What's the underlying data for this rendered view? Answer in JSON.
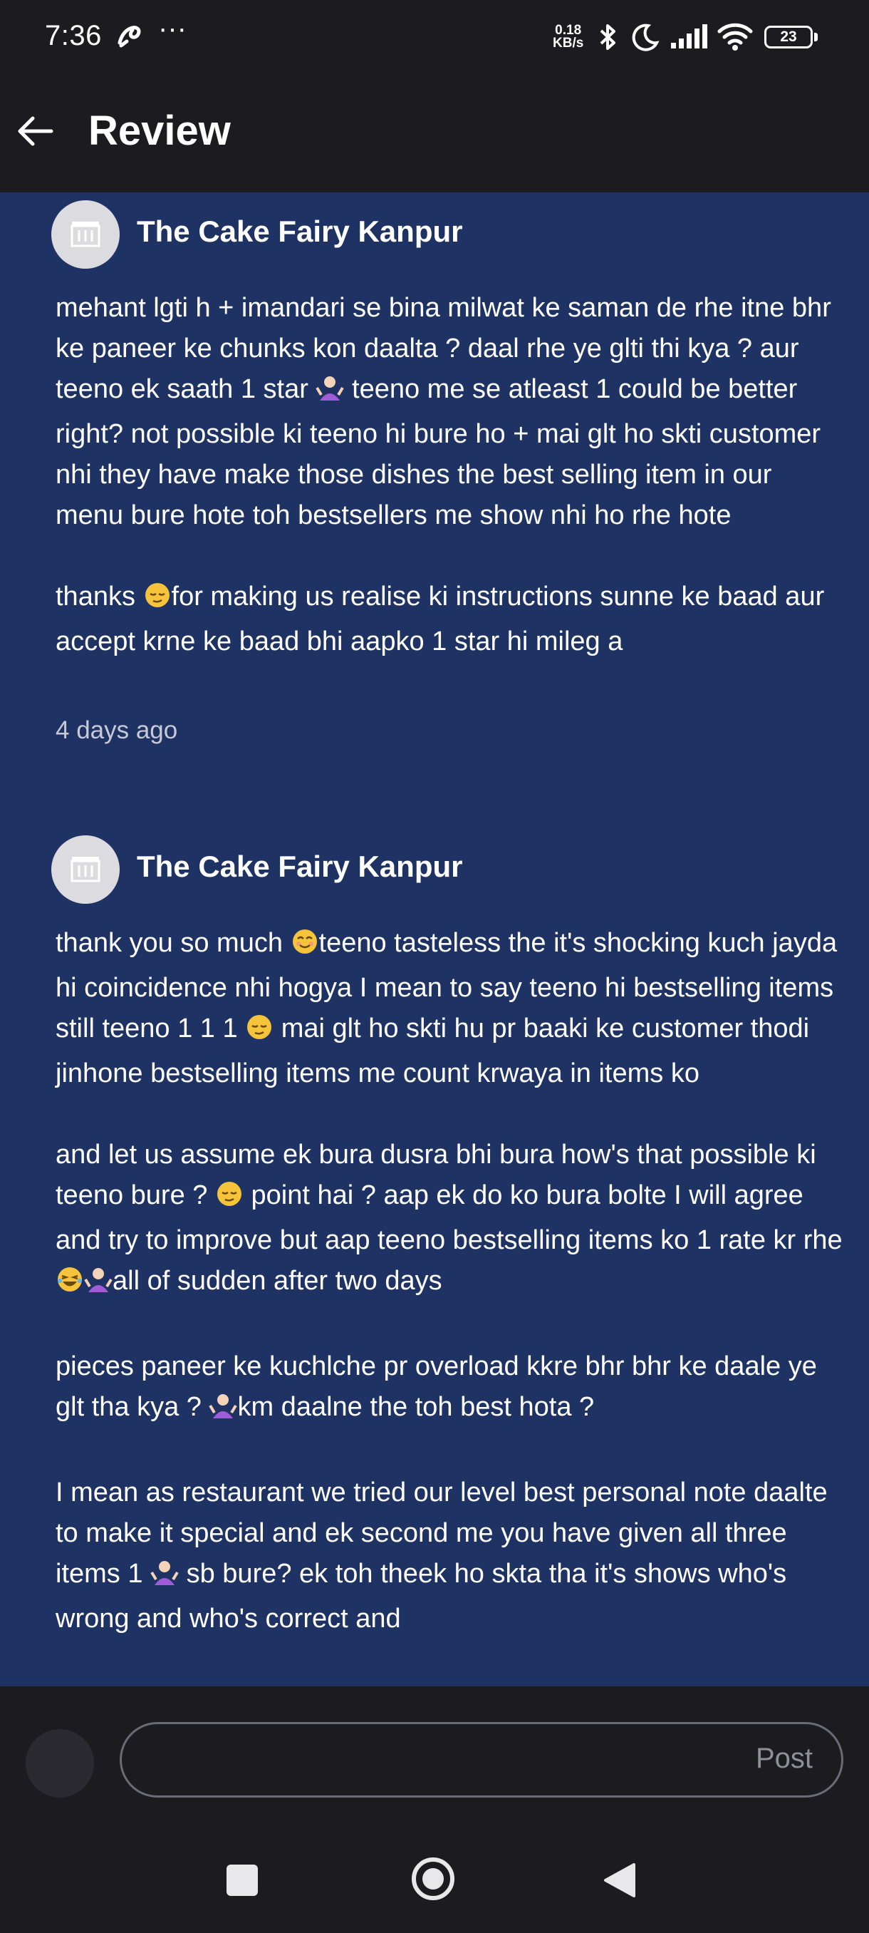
{
  "status_bar": {
    "time": "7:36",
    "dots": "···",
    "net_speed_value": "0.18",
    "net_speed_unit": "KB/s",
    "battery": "23"
  },
  "header": {
    "title": "Review"
  },
  "reviews": [
    {
      "name": "The Cake Fairy Kanpur",
      "body_p1": "mehant lgti h + imandari se bina milwat ke saman de rhe itne bhr ke paneer ke chunks kon daalta ? daal rhe ye glti thi kya ? aur teeno ek saath 1 star ",
      "body_p1_b": " teeno me se atleast 1 could be better right? not possible ki teeno hi bure ho + mai glt ho skti customer nhi they have make those dishes the best selling item in our menu bure hote toh bestsellers me show nhi ho rhe hote",
      "body_p2a": "thanks ",
      "body_p2b": "for making us realise ki instructions sunne ke baad aur accept krne ke baad bhi aapko 1 star hi mileg a",
      "time": "4 days ago"
    },
    {
      "name": "The Cake Fairy Kanpur",
      "p1a": "thank you so much ",
      "p1b": "teeno tasteless the it's shocking kuch jayda hi coincidence nhi hogya I mean to say teeno hi bestselling items still teeno 1 1 1 ",
      "p1c": " mai glt ho skti hu pr baaki ke customer thodi jinhone bestselling items me count krwaya in items ko",
      "p2a": "and let us assume ek bura dusra bhi bura how's that possible ki teeno bure ? ",
      "p2b": " point hai ? aap ek do ko bura bolte I will agree and try to improve but aap teeno bestselling items ko 1 rate kr rhe ",
      "p2c": "all of sudden after two days",
      "p3a": "pieces paneer ke kuchlche pr overload kkre bhr bhr ke daale ye glt tha kya ? ",
      "p3b": "km daalne the toh best hota ?",
      "p4a": "I mean as restaurant we tried our level best personal note daalte to make it special and ek second me you have given all three items 1 ",
      "p4b": " sb bure? ek toh theek ho skta tha it's shows who's wrong and who's correct and"
    }
  ],
  "composer": {
    "post_label": "Post"
  },
  "colors": {
    "content_bg": "#1e3264",
    "chrome_bg": "#1c1b20"
  }
}
